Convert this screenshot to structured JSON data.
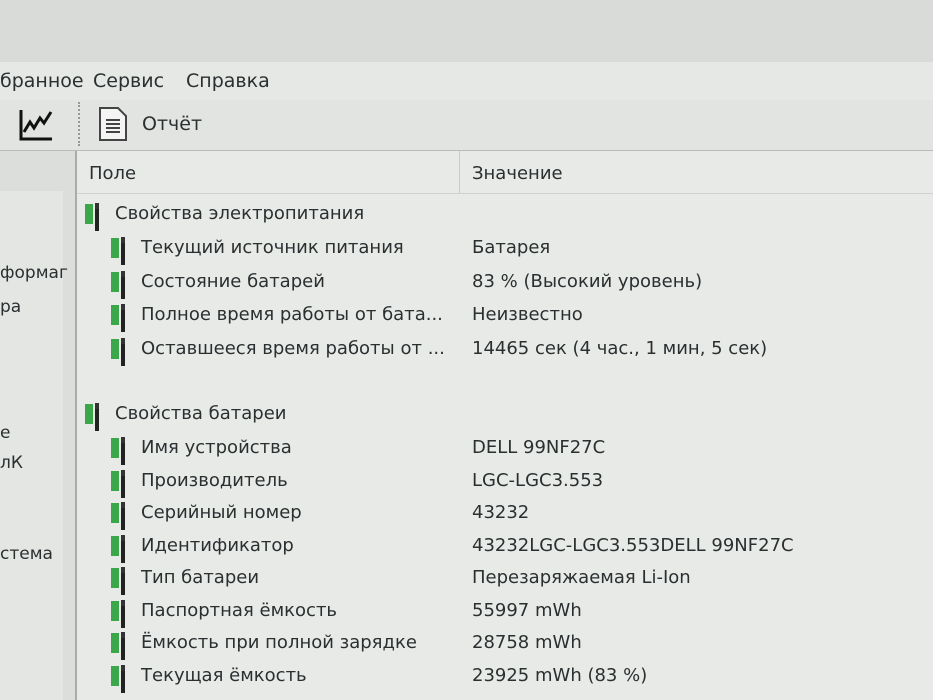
{
  "menu": [
    "бранное",
    "Сервис",
    "Справка"
  ],
  "toolbar": {
    "report_label": "Отчёт"
  },
  "left_pane": [
    "формаг",
    "ра",
    "е",
    "лК",
    "стема"
  ],
  "columns": {
    "field": "Поле",
    "value": "Значение"
  },
  "groups": [
    {
      "title": "Свойства электропитания",
      "rows": [
        {
          "field": "Текущий источник питания",
          "value": "Батарея"
        },
        {
          "field": "Состояние батарей",
          "value": "83 % (Высокий уровень)"
        },
        {
          "field": "Полное время работы от бата...",
          "value": "Неизвестно"
        },
        {
          "field": "Оставшееся время работы от ...",
          "value": "14465 сек (4 час., 1 мин, 5 сек)"
        }
      ]
    },
    {
      "title": "Свойства батареи",
      "rows": [
        {
          "field": "Имя устройства",
          "value": "DELL 99NF27C"
        },
        {
          "field": "Производитель",
          "value": "LGC-LGC3.553"
        },
        {
          "field": "Серийный номер",
          "value": "43232"
        },
        {
          "field": "Идентификатор",
          "value": "43232LGC-LGC3.553DELL 99NF27C"
        },
        {
          "field": "Тип батареи",
          "value": "Перезаряжаемая Li-Ion"
        },
        {
          "field": "Паспортная ёмкость",
          "value": "55997 mWh"
        },
        {
          "field": "Ёмкость при полной зарядке",
          "value": "28758 mWh"
        },
        {
          "field": "Текущая ёмкость",
          "value": "23925 mWh  (83 %)"
        }
      ]
    }
  ]
}
